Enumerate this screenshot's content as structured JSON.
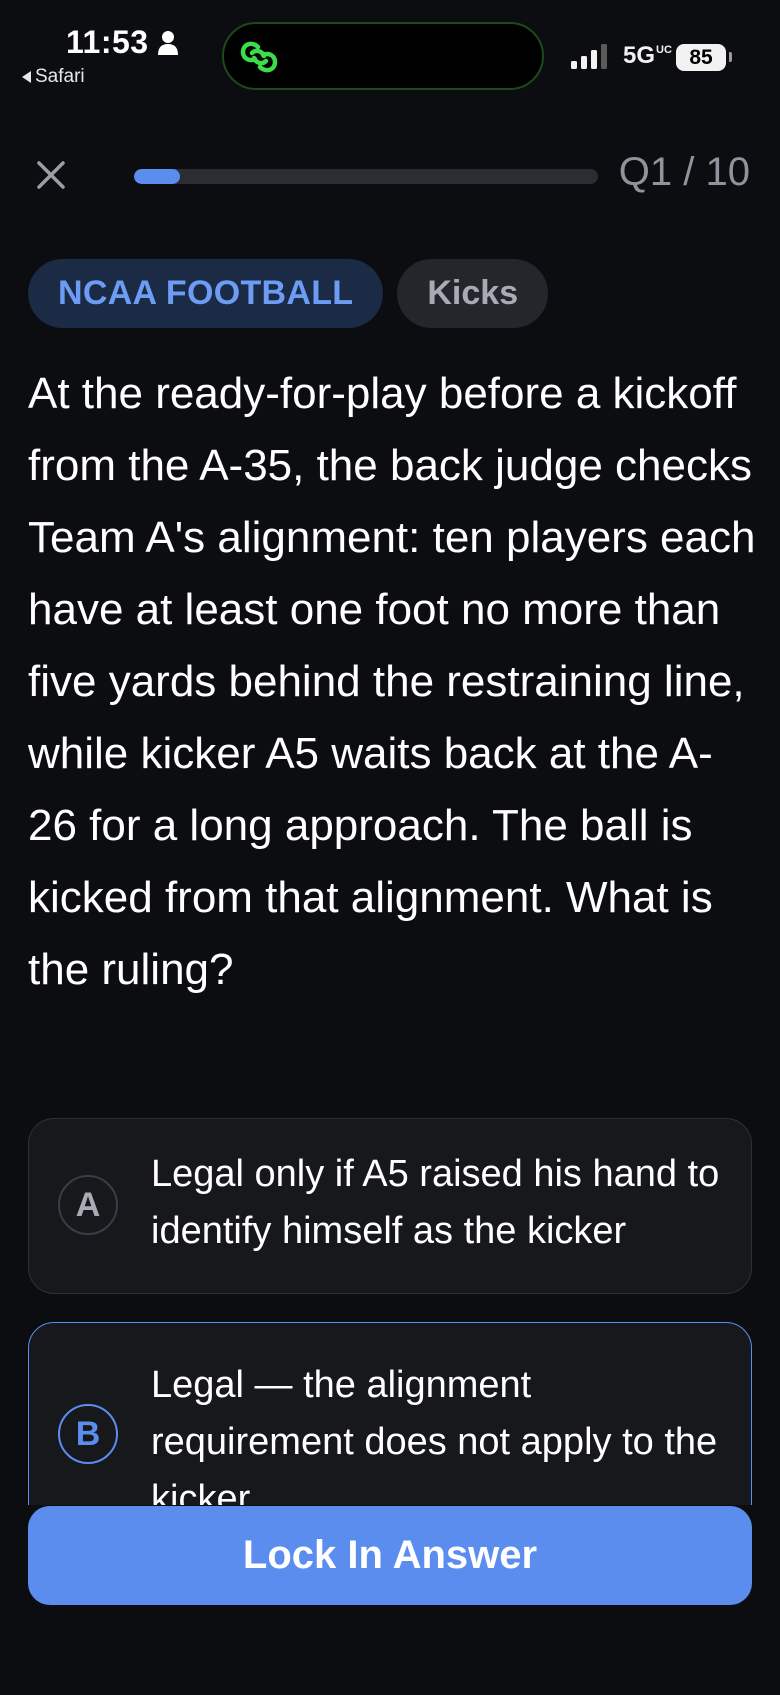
{
  "status_bar": {
    "time": "11:53",
    "back_app": "Safari",
    "network": "5G",
    "network_suffix": "UC",
    "battery": "85"
  },
  "quiz": {
    "counter": "Q1 / 10",
    "progress_fraction": 0.1,
    "accent_color": "#5b8def"
  },
  "tags": {
    "league": "NCAA FOOTBALL",
    "topic": "Kicks"
  },
  "question": {
    "text": "At the ready-for-play before a kickoff from the A-35, the back judge checks Team A's alignment: ten players each have at least one foot no more than five yards behind the restraining line, while kicker A5 waits back at the A-26 for a long approach. The ball is kicked from that alignment. What is the ruling?"
  },
  "options": [
    {
      "letter": "A",
      "text": "Legal only if A5 raised his hand to identify himself as the kicker",
      "selected": false
    },
    {
      "letter": "B",
      "text": "Legal — the alignment requirement does not apply to the kicker",
      "selected": true
    }
  ],
  "actions": {
    "lock_in": "Lock In Answer"
  }
}
